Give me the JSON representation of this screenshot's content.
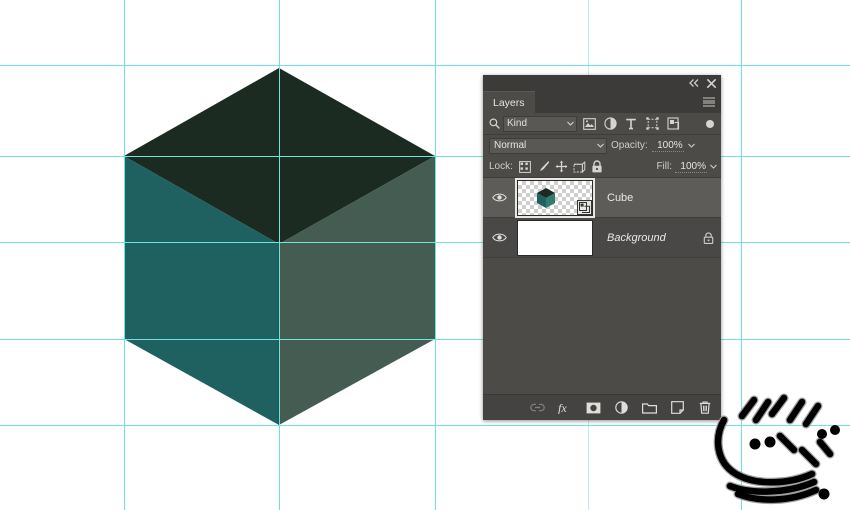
{
  "canvas": {
    "background_color": "#ffffff",
    "guide_color": "#6fe3e0",
    "guides_vertical": [
      124,
      279,
      435,
      588,
      741
    ],
    "guides_horizontal": [
      65,
      156,
      242,
      339,
      425
    ],
    "artwork": {
      "name": "isometric-cube",
      "top_face_color": "#1b2b21",
      "left_face_color": "#1f6061",
      "right_face_color": "#445c52",
      "edge_color": "#0e1a14"
    }
  },
  "panel": {
    "titlebar": {
      "collapse_label": "◂◂",
      "close_label": "✕"
    },
    "tab_label": "Layers",
    "menu_label": "Panel menu",
    "filter": {
      "search_icon": "magnifier-icon",
      "kind_label": "Kind",
      "icons": [
        "pixel-layer-icon",
        "adjustment-layer-icon",
        "type-layer-icon",
        "shape-layer-icon",
        "smart-object-icon"
      ],
      "toggle_label": "filter-toggle"
    },
    "blend": {
      "mode": "Normal",
      "opacity_label": "Opacity:",
      "opacity_value": "100%"
    },
    "lock": {
      "label": "Lock:",
      "items": [
        "lock-transparent-pixels",
        "lock-image-pixels",
        "lock-position",
        "lock-artboard-nesting",
        "lock-all"
      ],
      "fill_label": "Fill:",
      "fill_value": "100%"
    },
    "layers": [
      {
        "name": "Cube",
        "visible": true,
        "selected": true,
        "italic": false,
        "locked": false,
        "thumbnail": "transparent-with-cube",
        "badge": "smart-object-badge"
      },
      {
        "name": "Background",
        "visible": true,
        "selected": false,
        "italic": true,
        "locked": true,
        "thumbnail": "white",
        "badge": ""
      }
    ],
    "bottom_toolbar": [
      "link-layers-icon",
      "layer-style-fx-icon",
      "add-layer-mask-icon",
      "new-adjustment-layer-icon",
      "new-group-icon",
      "new-layer-icon",
      "delete-layer-icon"
    ],
    "colors": {
      "panel_bg": "#4d4b48",
      "header_bg": "#3d3b39",
      "row_selected": "#5e5c59",
      "text": "#e6e4e1"
    }
  },
  "watermark": {
    "name": "persian-calligraphy-logo"
  }
}
